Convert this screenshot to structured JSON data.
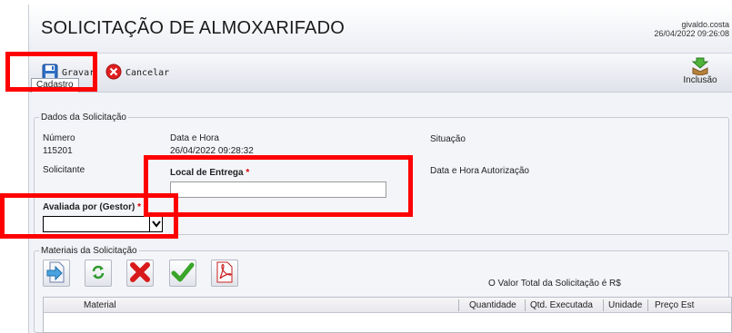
{
  "header": {
    "title": "SOLICITAÇÃO DE ALMOXARIFADO",
    "user": "givaldo.costa",
    "datetime": "26/04/2022 09:26:08"
  },
  "toolbar": {
    "save_label": "Gravar",
    "cancel_label": "Cancelar",
    "inclusao_label": "Inclusão"
  },
  "tabs": [
    "Cadastro"
  ],
  "dados": {
    "legend": "Dados da Solicitação",
    "numero_label": "Número",
    "numero_value": "115201",
    "data_hora_label": "Data e Hora",
    "data_hora_value": "26/04/2022 09:28:32",
    "situacao_label": "Situação",
    "solicitante_label": "Solicitante",
    "local_entrega_label": "Local de Entrega",
    "data_autorizacao_label": "Data e Hora Autorização",
    "avaliada_label": "Avaliada por (Gestor)",
    "required_mark": "*"
  },
  "materiais": {
    "legend": "Materiais da Solicitação",
    "total_text": "O Valor Total da Solicitação é R$",
    "columns": [
      "Material",
      "Quantidade",
      "Qtd. Executada",
      "Unidade",
      "Preço Est"
    ]
  },
  "colors": {
    "highlight": "#ff0000",
    "required": "#d40000",
    "accept_green": "#3aa52a",
    "delete_red": "#d81a1a"
  }
}
